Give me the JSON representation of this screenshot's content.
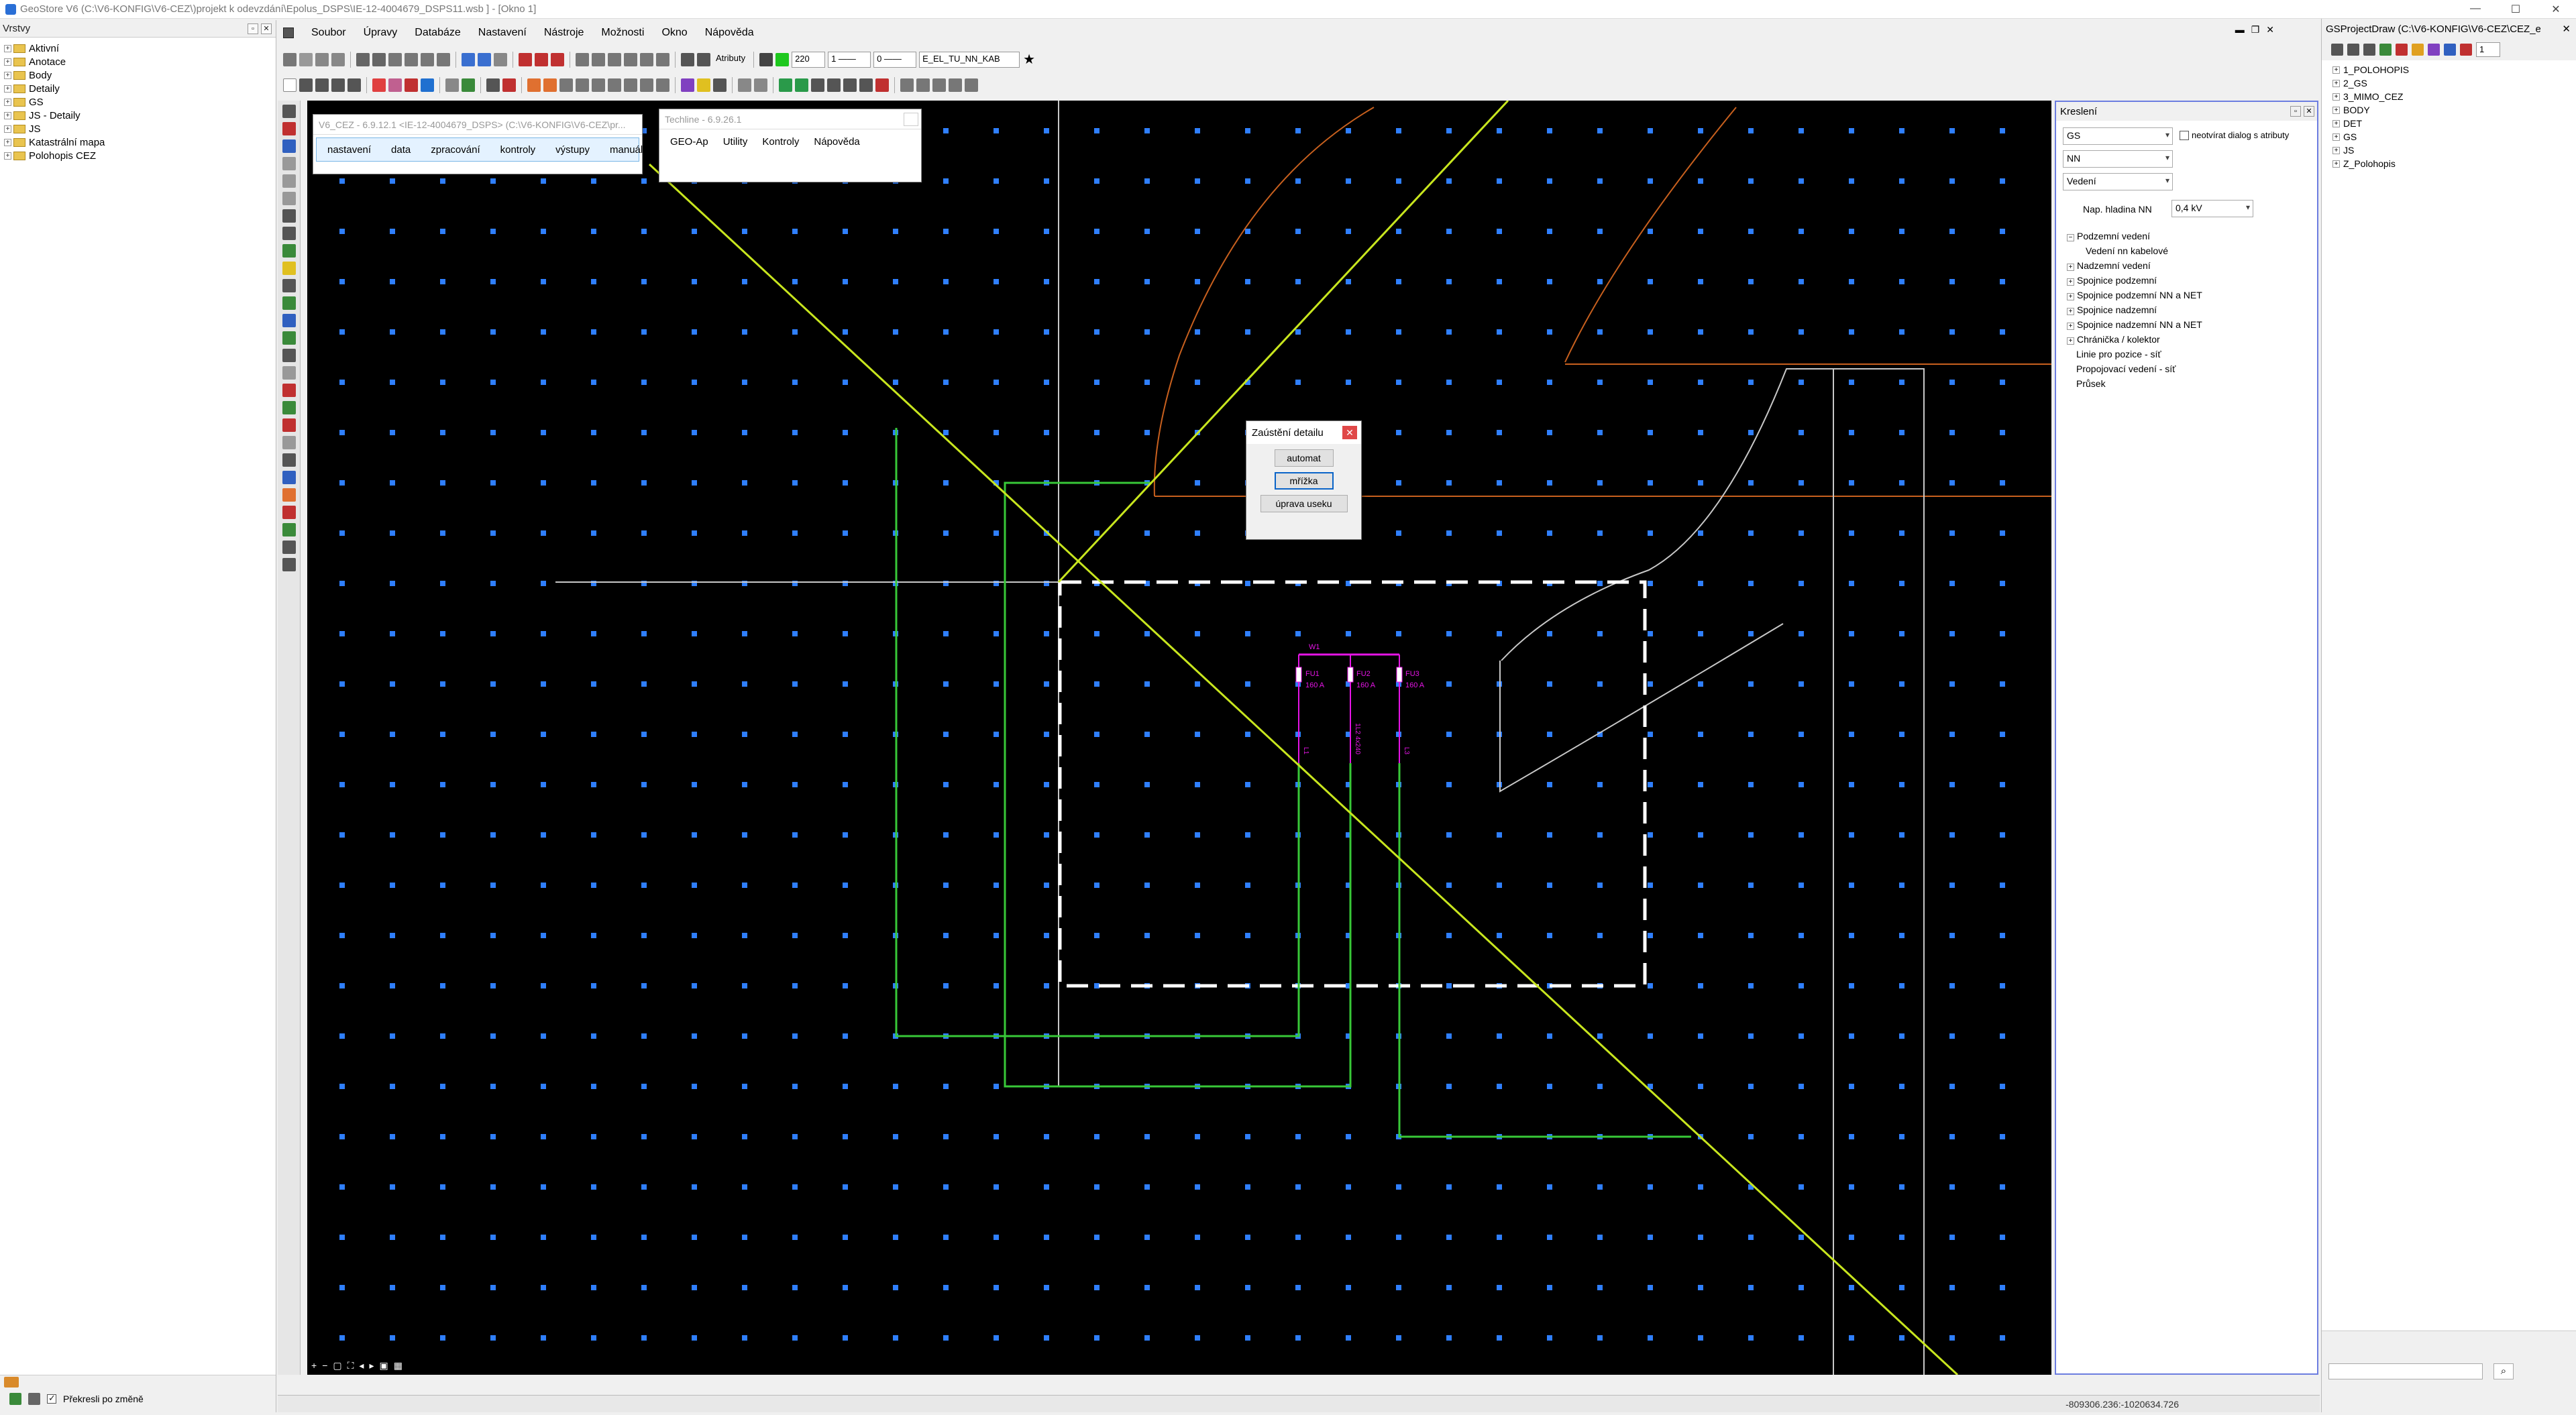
{
  "title_bar": {
    "title": "GeoStore V6 (C:\\V6-KONFIG\\V6-CEZ\\)projekt k odevzdání\\Epolus_DSPS\\IE-12-4004679_DSPS11.wsb ] - [Okno 1]",
    "min": "—",
    "max": "☐",
    "close": "✕"
  },
  "layers": {
    "title": "Vrstvy",
    "items": [
      "Aktivní",
      "Anotace",
      "Body",
      "Detaily",
      "GS",
      "JS - Detaily",
      "JS",
      "Katastrální mapa",
      "Polohopis CEZ"
    ],
    "redraw_label": "Překresli po změně",
    "redraw_checked": true
  },
  "menu": {
    "items": [
      "Soubor",
      "Úpravy",
      "Databáze",
      "Nastavení",
      "Nástroje",
      "Možnosti",
      "Okno",
      "Nápověda"
    ]
  },
  "toolbar": {
    "layer_value": "220",
    "line_style": "1 ——",
    "line_width": "0 ——",
    "layer_name": "E_EL_TU_NN_KAB",
    "attributes_label": "Atributy"
  },
  "cez_window": {
    "title": "V6_CEZ - 6.9.12.1 <IE-12-4004679_DSPS> (C:\\V6-KONFIG\\V6-CEZ\\pr...",
    "menu": [
      "nastavení",
      "data",
      "zpracování",
      "kontroly",
      "výstupy",
      "manuál"
    ]
  },
  "techline_window": {
    "title": "Techline - 6.9.26.1",
    "menu": [
      "GEO-Ap",
      "Utility",
      "Kontroly",
      "Nápověda"
    ]
  },
  "dialog": {
    "title": "Zaústění detailu",
    "buttons": [
      "automat",
      "mřížka",
      "úprava useku"
    ]
  },
  "drawing": {
    "node_label": "W1",
    "fuses": [
      {
        "name": "FU1",
        "current": "160 A"
      },
      {
        "name": "FU2",
        "current": "160 A"
      },
      {
        "name": "FU3",
        "current": "160 A"
      }
    ],
    "cable_labels": [
      "L1",
      "1L2 4x240",
      "L3"
    ],
    "colors": {
      "grid_dot": "#2f7fff",
      "green_line": "#38c838",
      "yellow_line": "#c8e61e",
      "white_line": "#ffffff",
      "orange_line": "#c8601e",
      "magenta": "#e614e6"
    }
  },
  "kresleni": {
    "title": "Kreslení",
    "combo1": "GS",
    "checkbox_label": "neotvírat dialog s atributy",
    "combo2": "NN",
    "combo3": "Vedení",
    "voltage_label": "Nap. hladina NN",
    "voltage_value": "0,4 kV",
    "tree": [
      {
        "label": "Podzemní vedení",
        "expanded": true
      },
      {
        "label": "Vedení nn kabelové",
        "child": true
      },
      {
        "label": "Nadzemní vedení"
      },
      {
        "label": "Spojnice podzemní"
      },
      {
        "label": "Spojnice podzemní NN a NET"
      },
      {
        "label": "Spojnice nadzemní"
      },
      {
        "label": "Spojnice nadzemní NN a NET"
      },
      {
        "label": "Chránička / kolektor"
      },
      {
        "label": "Linie pro pozice - síť",
        "leaf": true
      },
      {
        "label": "Propojovací vedení - síť",
        "leaf": true
      },
      {
        "label": "Průsek",
        "leaf": true
      }
    ]
  },
  "project_panel": {
    "title": "GSProjectDraw (C:\\V6-KONFIG\\V6-CEZ\\CEZ_e...",
    "page_value": "1",
    "items": [
      "1_POLOHOPIS",
      "2_GS",
      "3_MIMO_CEZ",
      "BODY",
      "DET",
      "GS",
      "JS",
      "Z_Polohopis"
    ]
  },
  "status": {
    "coords": "-809306.236:-1020634.726"
  }
}
